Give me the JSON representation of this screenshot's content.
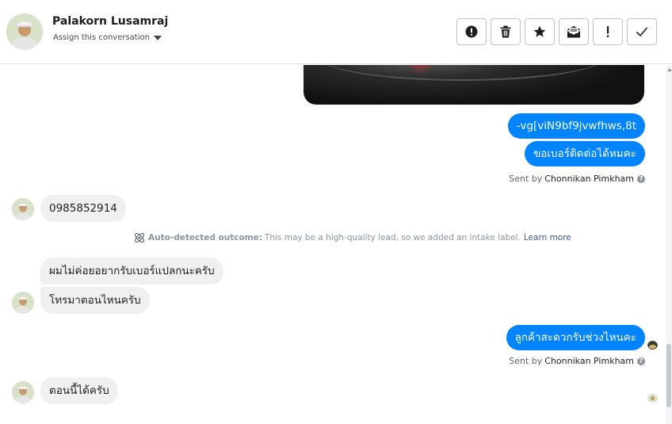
{
  "header": {
    "contact_name": "Palakorn Lusamraj",
    "assign_label": "Assign this conversation",
    "actions": [
      {
        "name": "spam-button",
        "icon": "exclamation-circle-icon"
      },
      {
        "name": "delete-button",
        "icon": "trash-icon"
      },
      {
        "name": "star-button",
        "icon": "star-icon"
      },
      {
        "name": "mark-unread-button",
        "icon": "envelope-icon"
      },
      {
        "name": "follow-up-button",
        "icon": "exclamation-icon"
      },
      {
        "name": "done-button",
        "icon": "checkmark-icon"
      }
    ]
  },
  "messages": {
    "out_1": "-vg[viN9bf9jvwfhws,8t",
    "out_2": "ขอเบอร์ติดต่อได้หมคะ",
    "sent_by_prefix": "Sent by",
    "sent_by_name": "Chonnikan Pimkham",
    "in_1": "0985852914",
    "outcome_label": "Auto-detected outcome:",
    "outcome_text": "This may be a high-quality lead, so we added an intake label.",
    "outcome_link": "Learn more",
    "in_2": "ผมไม่ค่อยอยากรับเบอร์แปลกนะครับ",
    "in_3": "โทรมาตอนไหนครับ",
    "out_3": "ลูกค้าสะดวกรับช่วงไหนคะ",
    "in_4": "ตอนนี้ได้ครับ"
  },
  "colors": {
    "outgoing_bubble": "#0084ff",
    "incoming_bubble": "#f1f0f0",
    "link": "#385898"
  }
}
